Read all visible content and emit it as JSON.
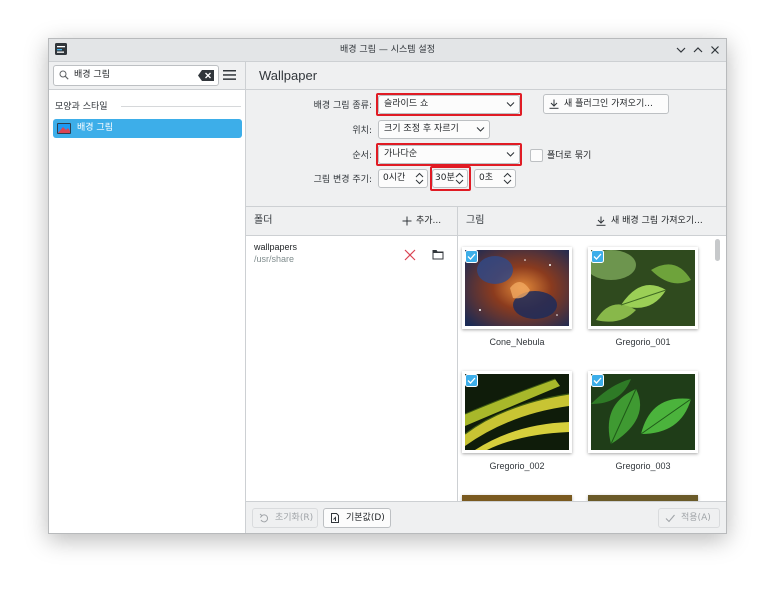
{
  "window": {
    "title": "배경 그림 — 시스템 설정"
  },
  "sidebar": {
    "search_value": "배경 그림",
    "section_label": "모양과 스타일",
    "items": [
      {
        "label": "배경 그림",
        "selected": true
      }
    ]
  },
  "page": {
    "title": "Wallpaper"
  },
  "form": {
    "wallpaper_type_label": "배경 그림 종류:",
    "wallpaper_type_value": "슬라이드 쇼",
    "get_plugins_label": "새 플러그인 가져오기...",
    "position_label": "위치:",
    "position_value": "크기 조정 후 자르기",
    "order_label": "순서:",
    "order_value": "가나다순",
    "group_by_folder_label": "폴더로 묶기",
    "group_by_folder_checked": false,
    "interval_label": "그림 변경 주기:",
    "interval_hours": "0시간",
    "interval_minutes": "30분",
    "interval_seconds": "0초"
  },
  "folders_panel": {
    "title": "폴더",
    "add_label": "추가...",
    "items": [
      {
        "name": "wallpapers",
        "path": "/usr/share"
      }
    ]
  },
  "images_panel": {
    "title": "그림",
    "get_new_label": "새 배경 그림 가져오기...",
    "items": [
      {
        "label": "Cone_Nebula",
        "checked": true
      },
      {
        "label": "Gregorio_001",
        "checked": true
      },
      {
        "label": "Gregorio_002",
        "checked": true
      },
      {
        "label": "Gregorio_003",
        "checked": true
      }
    ]
  },
  "footer": {
    "reset_label": "초기화(R)",
    "defaults_label": "기본값(D)",
    "apply_label": "적용(A)"
  },
  "colors": {
    "accent": "#3daee9",
    "highlight_box": "#e01b24",
    "delete_icon": "#da4453"
  }
}
